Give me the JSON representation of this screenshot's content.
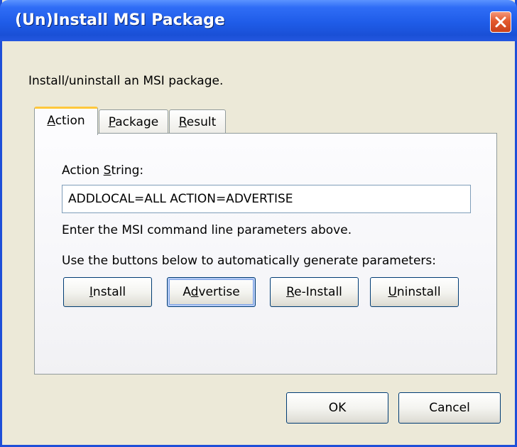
{
  "window": {
    "title": "(Un)Install MSI Package",
    "close_icon": "close-icon"
  },
  "description": "Install/uninstall an MSI package.",
  "tabs": [
    {
      "label": "Action",
      "mnemonic": "A",
      "active": true
    },
    {
      "label": "Package",
      "mnemonic": "P",
      "active": false
    },
    {
      "label": "Result",
      "mnemonic": "R",
      "active": false
    }
  ],
  "action_panel": {
    "action_string_label": "Action String:",
    "action_string_mnemonic": "S",
    "action_string_value": "ADDLOCAL=ALL ACTION=ADVERTISE",
    "hint": "Enter the MSI command line parameters above.",
    "generate_hint": "Use the buttons below to automatically generate parameters:",
    "buttons": [
      {
        "label": "Install",
        "mnemonic": "I"
      },
      {
        "label": "Advertise",
        "mnemonic": "d"
      },
      {
        "label": "Re-Install",
        "mnemonic": "R"
      },
      {
        "label": "Uninstall",
        "mnemonic": "U"
      }
    ]
  },
  "footer": {
    "ok_label": "OK",
    "cancel_label": "Cancel"
  },
  "colors": {
    "titlebar": "#1f5ce8",
    "dialog_bg": "#ece9d8",
    "active_tab_accent": "#ffc83c",
    "button_border": "#003c74"
  }
}
